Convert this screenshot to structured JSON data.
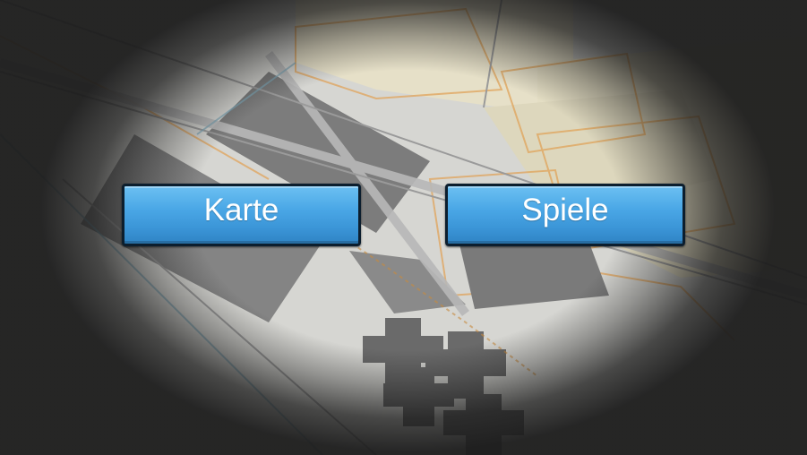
{
  "menu": {
    "buttons": [
      {
        "label": "Karte"
      },
      {
        "label": "Spiele"
      }
    ]
  },
  "colors": {
    "button_top": "#6cc0f2",
    "button_bottom": "#2f84c4",
    "button_border": "#0c1e2e",
    "button_text": "#ffffff",
    "background_dark": "#1e1e1e"
  },
  "icons": []
}
